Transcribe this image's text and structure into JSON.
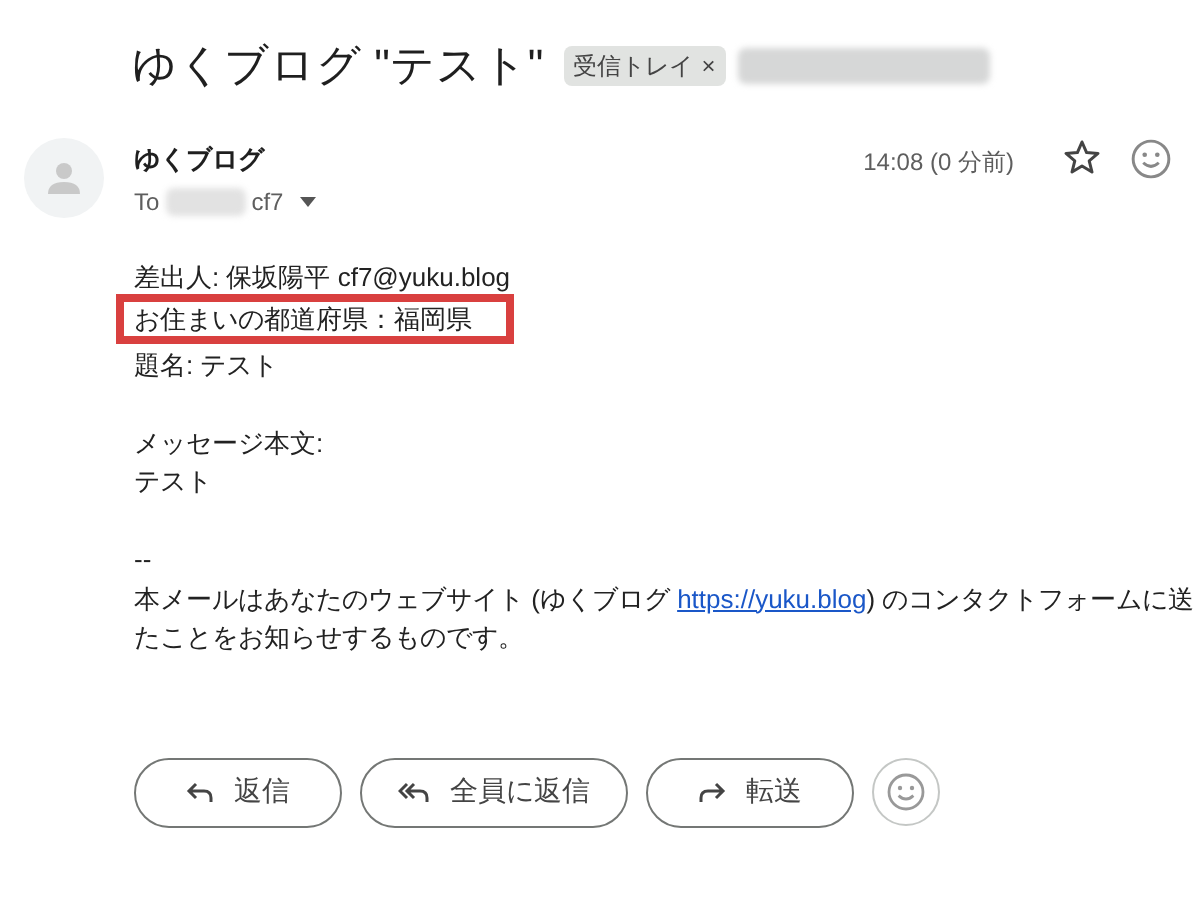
{
  "subject": {
    "title": "ゆくブログ \"テスト\"",
    "labels": [
      {
        "kind": "label",
        "text": "受信トレイ",
        "close": "×"
      },
      {
        "kind": "redacted"
      }
    ]
  },
  "message": {
    "sender": "ゆくブログ",
    "to_label": "To",
    "recipients": [
      {
        "kind": "redacted"
      },
      {
        "kind": "text",
        "text": "cf7"
      }
    ],
    "time": "14:08 (0 分前)",
    "starred": false,
    "body": [
      {
        "kind": "text",
        "text": "差出人: 保坂陽平 cf7@yuku.blog",
        "highlighted": false
      },
      {
        "kind": "text",
        "text": "お住まいの都道府県：福岡県",
        "highlighted": true
      },
      {
        "kind": "text",
        "text": "題名: テスト",
        "highlighted": false
      },
      {
        "kind": "blank"
      },
      {
        "kind": "text",
        "text": "メッセージ本文:",
        "highlighted": false
      },
      {
        "kind": "text",
        "text": "テスト",
        "highlighted": false
      },
      {
        "kind": "blank"
      },
      {
        "kind": "text",
        "text": "--",
        "highlighted": false
      },
      {
        "kind": "link",
        "before": "本メールはあなたのウェブサイト (ゆくブログ ",
        "link": "https://yuku.blog",
        "after": ") のコンタクトフォームに送",
        "highlighted": false
      },
      {
        "kind": "text",
        "text": "たことをお知らせするものです。",
        "highlighted": false
      }
    ]
  },
  "actions": [
    {
      "kind": "reply",
      "label": "返信"
    },
    {
      "kind": "reply_all",
      "label": "全員に返信"
    },
    {
      "kind": "forward",
      "label": "転送"
    },
    {
      "kind": "emoji"
    }
  ]
}
